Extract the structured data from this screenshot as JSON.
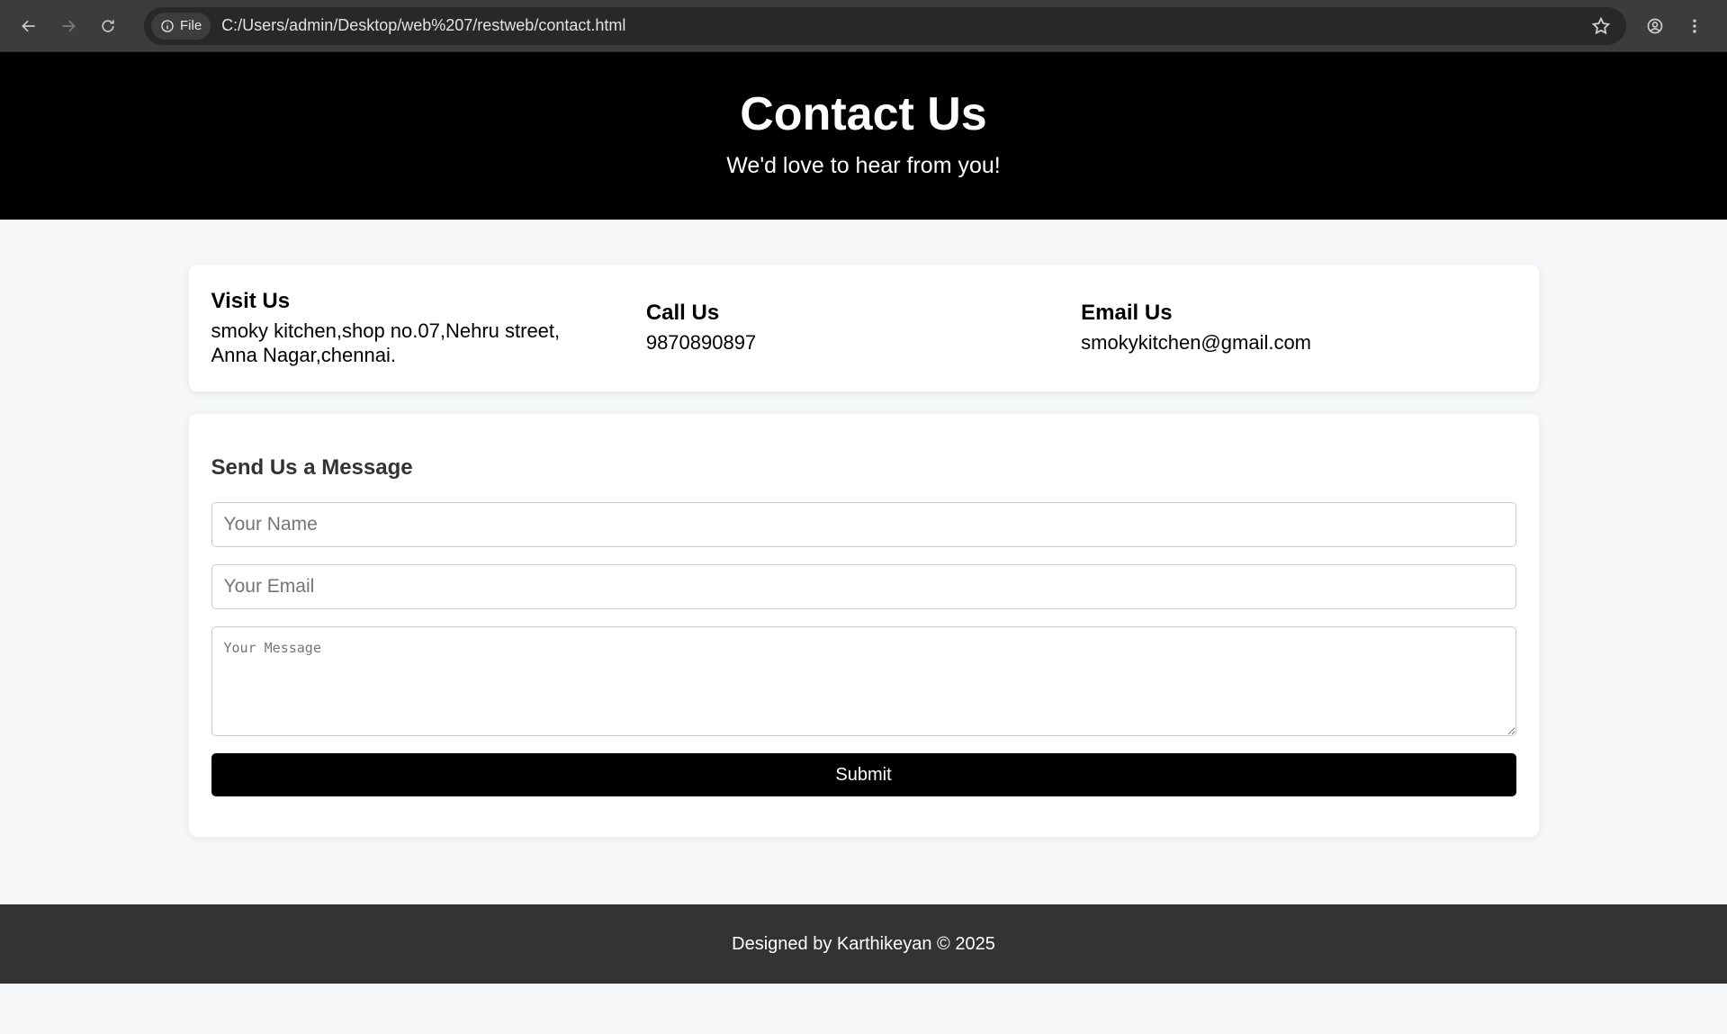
{
  "browser": {
    "file_chip_label": "File",
    "url": "C:/Users/admin/Desktop/web%207/restweb/contact.html"
  },
  "hero": {
    "title": "Contact Us",
    "subtitle": "We'd love to hear from you!"
  },
  "info": {
    "visit": {
      "heading": "Visit Us",
      "text": "smoky kitchen,shop no.07,Nehru street, Anna Nagar,chennai."
    },
    "call": {
      "heading": "Call Us",
      "text": "9870890897"
    },
    "email": {
      "heading": "Email Us",
      "text": "smokykitchen@gmail.com"
    }
  },
  "form": {
    "heading": "Send Us a Message",
    "name_placeholder": "Your Name",
    "email_placeholder": "Your Email",
    "message_placeholder": "Your Message",
    "submit_label": "Submit"
  },
  "footer": {
    "text": "Designed by Karthikeyan © 2025"
  }
}
